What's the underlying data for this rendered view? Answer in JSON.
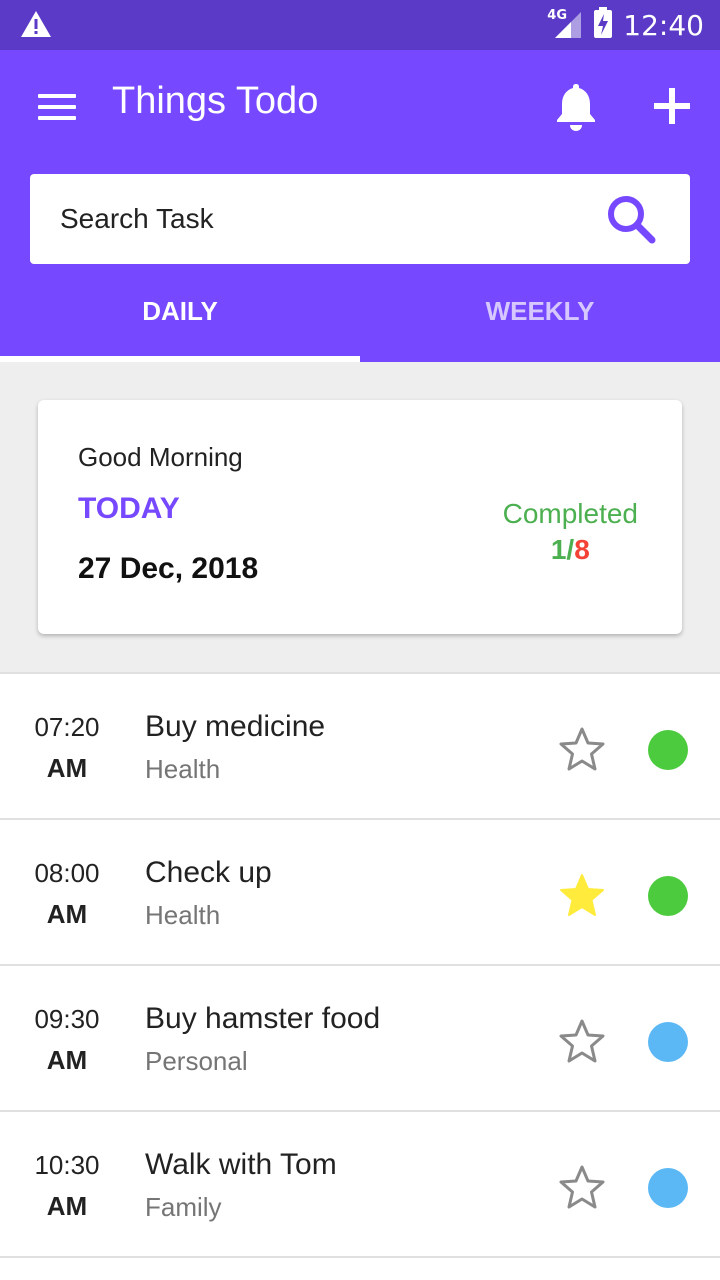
{
  "status_bar": {
    "network": "4G",
    "time": "12:40"
  },
  "app_bar": {
    "title": "Things Todo"
  },
  "search": {
    "placeholder": "Search Task"
  },
  "tabs": [
    {
      "label": "DAILY",
      "active": true
    },
    {
      "label": "WEEKLY",
      "active": false
    }
  ],
  "summary": {
    "greeting": "Good Morning",
    "today_label": "TODAY",
    "date": "27 Dec, 2018",
    "completed_label": "Completed",
    "completed_done": "1",
    "completed_sep": "/",
    "completed_total": "8"
  },
  "colors": {
    "accent": "#7648ff",
    "status_bar": "#5a3ac6",
    "health": "#4ccb3e",
    "personal": "#5bb8f5",
    "star_active": "#ffeb3b"
  },
  "tasks": [
    {
      "time": "07:20",
      "ampm": "AM",
      "title": "Buy medicine",
      "category": "Health",
      "starred": false,
      "color": "#4ccb3e"
    },
    {
      "time": "08:00",
      "ampm": "AM",
      "title": "Check up",
      "category": "Health",
      "starred": true,
      "color": "#4ccb3e"
    },
    {
      "time": "09:30",
      "ampm": "AM",
      "title": "Buy hamster food",
      "category": "Personal",
      "starred": false,
      "color": "#5bb8f5"
    },
    {
      "time": "10:30",
      "ampm": "AM",
      "title": "Walk with Tom",
      "category": "Family",
      "starred": false,
      "color": "#5bb8f5"
    }
  ]
}
